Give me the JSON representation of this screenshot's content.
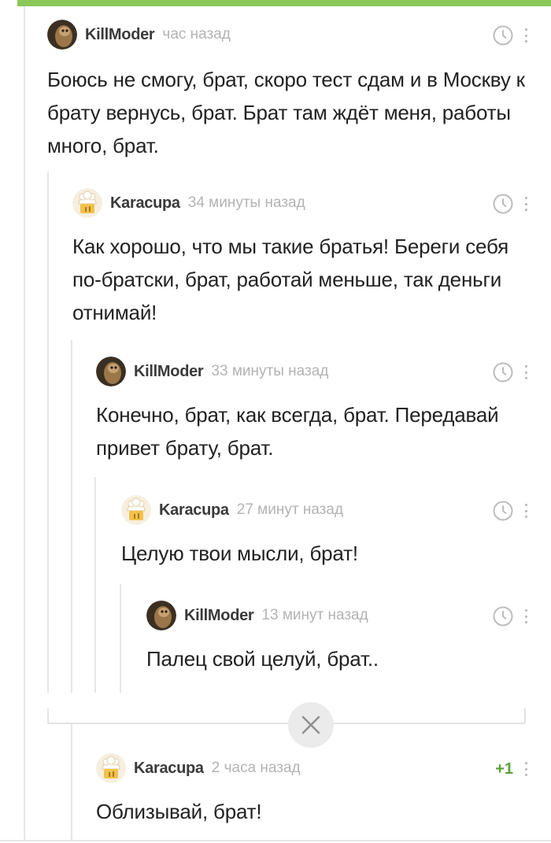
{
  "comments": [
    {
      "author": "KillModer",
      "time": "час назад",
      "text": "Боюсь не смогу, брат, скоро тест сдам и в Москву к брату вернусь, брат. Брат там ждёт меня, работы много, брат."
    },
    {
      "author": "Karacupa",
      "time": "34 минуты назад",
      "text": "Как хорошо, что мы такие братья! Береги себя по-братски, брат, работай меньше, так деньги отнимай!"
    },
    {
      "author": "KillModer",
      "time": "33 минуты назад",
      "text": "Конечно, брат, как всегда, брат. Передавай привет брату, брат."
    },
    {
      "author": "Karacupa",
      "time": "27 минут назад",
      "text": "Целую твои мысли, брат!"
    },
    {
      "author": "KillModer",
      "time": "13 минут назад",
      "text": "Палец свой целуй, брат.."
    },
    {
      "author": "Karacupa",
      "time": "2 часа назад",
      "rating": "+1",
      "text": "Облизывай, брат!"
    }
  ],
  "icons": {
    "timer": "clock-icon",
    "menu": "more-vertical-icon",
    "collapse": "close-icon"
  },
  "colors": {
    "accent": "#8ac858",
    "rating": "#5ca23b",
    "muted": "#b3b3b3"
  }
}
